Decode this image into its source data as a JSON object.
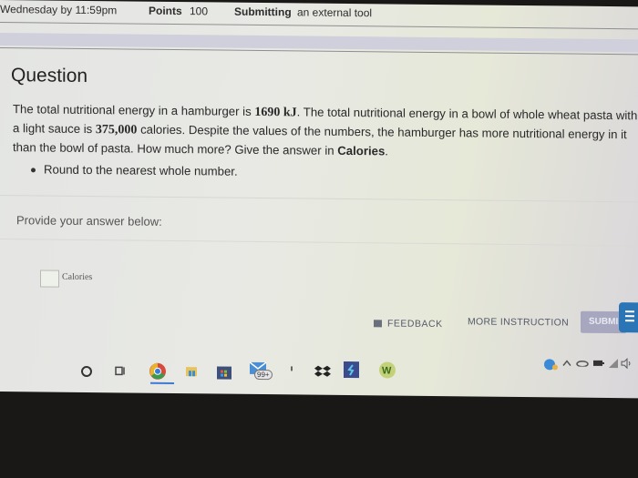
{
  "header": {
    "due": "Wednesday by 11:59pm",
    "points_label": "Points",
    "points_value": "100",
    "submitting_label": "Submitting",
    "submitting_value": "an external tool"
  },
  "question": {
    "title": "Question",
    "text_parts": [
      "The total nutritional energy in a hamburger is ",
      "1690 kJ",
      ". The total nutritional energy in a bowl of whole wheat pasta with a light sauce is ",
      "375,000",
      " calories. Despite the values of the numbers, the hamburger has more nutritional energy in it than the bowl of pasta. How much more? Give the answer in ",
      "Calories",
      "."
    ],
    "bullet": "Round to the nearest whole number."
  },
  "answer": {
    "prompt": "Provide your answer below:",
    "value": "",
    "unit": "Calories"
  },
  "actions": {
    "feedback": "FEEDBACK",
    "more_instruction": "MORE INSTRUCTION",
    "submit": "SUBMI"
  },
  "taskbar": {
    "icons": [
      "cortana-search",
      "task-view",
      "chrome",
      "file-explorer",
      "microsoft-store",
      "mail",
      "dropbox",
      "app-s",
      "app-w"
    ],
    "mail_badge": "99+",
    "tray_icons": [
      "onedrive-sync",
      "chevron-up",
      "cloud",
      "battery",
      "wifi",
      "volume"
    ]
  },
  "colors": {
    "submit_bg": "#a7a8c0",
    "chat_bg": "#2a75b6",
    "chrome_active": "#3b7bd6"
  }
}
